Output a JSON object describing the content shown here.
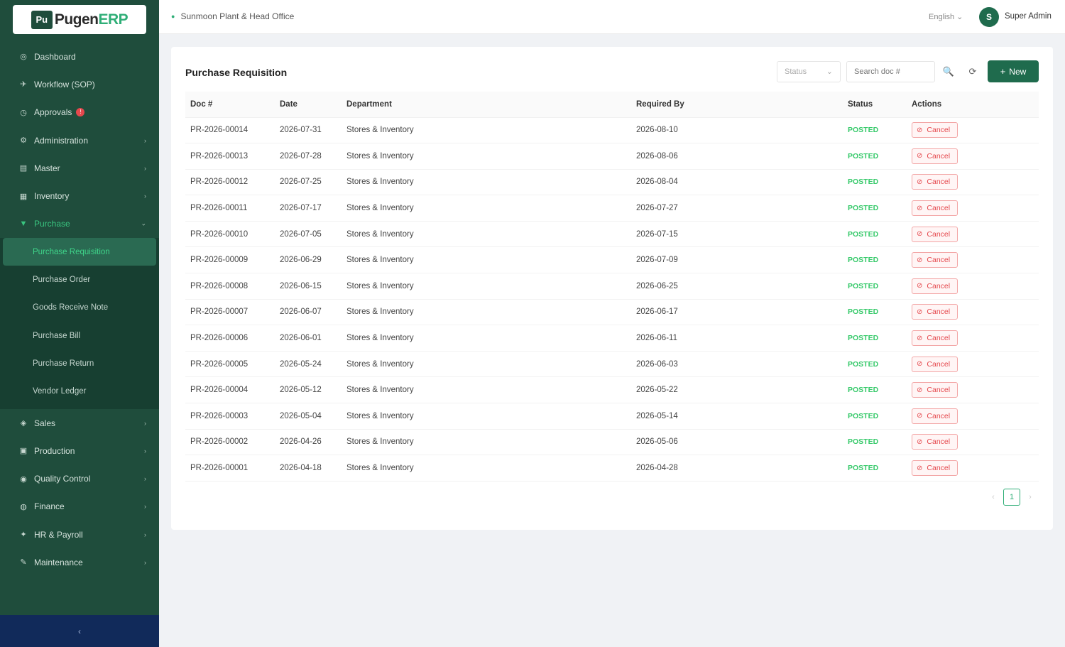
{
  "brand": {
    "logo_mark": "Pu",
    "logo_name": "Pugen",
    "logo_suffix": "ERP"
  },
  "sidebar": {
    "items": [
      {
        "icon": "◎",
        "icon_name": "dashboard-icon",
        "label": "Dashboard",
        "chevron": ""
      },
      {
        "icon": "✈",
        "icon_name": "workflow-icon",
        "label": "Workflow (SOP)",
        "chevron": ""
      },
      {
        "icon": "◷",
        "icon_name": "approvals-icon",
        "label": "Approvals",
        "chevron": "",
        "badge": "!"
      },
      {
        "icon": "⚙",
        "icon_name": "settings-icon",
        "label": "Administration",
        "chevron": "›"
      },
      {
        "icon": "▤",
        "icon_name": "master-icon",
        "label": "Master",
        "chevron": "›"
      },
      {
        "icon": "▦",
        "icon_name": "inventory-icon",
        "label": "Inventory",
        "chevron": "›"
      },
      {
        "icon": "▼",
        "icon_name": "purchase-icon",
        "label": "Purchase",
        "chevron": "⌄"
      }
    ],
    "purchase_sub": [
      {
        "label": "Purchase Requisition"
      },
      {
        "label": "Purchase Order"
      },
      {
        "label": "Goods Receive Note"
      },
      {
        "label": "Purchase Bill"
      },
      {
        "label": "Purchase Return"
      },
      {
        "label": "Vendor Ledger"
      }
    ],
    "items_after": [
      {
        "icon": "◈",
        "icon_name": "sales-icon",
        "label": "Sales",
        "chevron": "›"
      },
      {
        "icon": "▣",
        "icon_name": "production-icon",
        "label": "Production",
        "chevron": "›"
      },
      {
        "icon": "◉",
        "icon_name": "quality-icon",
        "label": "Quality Control",
        "chevron": "›"
      },
      {
        "icon": "◍",
        "icon_name": "finance-icon",
        "label": "Finance",
        "chevron": "›"
      },
      {
        "icon": "✦",
        "icon_name": "hr-icon",
        "label": "HR & Payroll",
        "chevron": "›"
      },
      {
        "icon": "✎",
        "icon_name": "maintenance-icon",
        "label": "Maintenance",
        "chevron": "›"
      }
    ],
    "collapse_label": "‹"
  },
  "header": {
    "breadcrumb_icon": "●",
    "breadcrumb": "Sunmoon Plant & Head Office",
    "language": "English ⌄",
    "avatar_initial": "S",
    "user_name": "Super Admin"
  },
  "card": {
    "title": "Purchase Requisition",
    "status_filter": "Status",
    "status_caret": "⌄",
    "search_placeholder": "Search doc #",
    "search_icon": "🔍",
    "refresh_icon": "⟳",
    "new_label": "New",
    "new_plus": "+"
  },
  "table": {
    "columns": [
      "Doc #",
      "Date",
      "Department",
      "Required By",
      "Status",
      "Actions"
    ],
    "cancel_label": "Cancel",
    "cancel_icon": "⊘",
    "rows": [
      {
        "doc": "PR-2026-00014",
        "date": "2026-07-31",
        "dept": "Stores & Inventory",
        "req": "2026-08-10",
        "status": "POSTED"
      },
      {
        "doc": "PR-2026-00013",
        "date": "2026-07-28",
        "dept": "Stores & Inventory",
        "req": "2026-08-06",
        "status": "POSTED"
      },
      {
        "doc": "PR-2026-00012",
        "date": "2026-07-25",
        "dept": "Stores & Inventory",
        "req": "2026-08-04",
        "status": "POSTED"
      },
      {
        "doc": "PR-2026-00011",
        "date": "2026-07-17",
        "dept": "Stores & Inventory",
        "req": "2026-07-27",
        "status": "POSTED"
      },
      {
        "doc": "PR-2026-00010",
        "date": "2026-07-05",
        "dept": "Stores & Inventory",
        "req": "2026-07-15",
        "status": "POSTED"
      },
      {
        "doc": "PR-2026-00009",
        "date": "2026-06-29",
        "dept": "Stores & Inventory",
        "req": "2026-07-09",
        "status": "POSTED"
      },
      {
        "doc": "PR-2026-00008",
        "date": "2026-06-15",
        "dept": "Stores & Inventory",
        "req": "2026-06-25",
        "status": "POSTED"
      },
      {
        "doc": "PR-2026-00007",
        "date": "2026-06-07",
        "dept": "Stores & Inventory",
        "req": "2026-06-17",
        "status": "POSTED"
      },
      {
        "doc": "PR-2026-00006",
        "date": "2026-06-01",
        "dept": "Stores & Inventory",
        "req": "2026-06-11",
        "status": "POSTED"
      },
      {
        "doc": "PR-2026-00005",
        "date": "2026-05-24",
        "dept": "Stores & Inventory",
        "req": "2026-06-03",
        "status": "POSTED"
      },
      {
        "doc": "PR-2026-00004",
        "date": "2026-05-12",
        "dept": "Stores & Inventory",
        "req": "2026-05-22",
        "status": "POSTED"
      },
      {
        "doc": "PR-2026-00003",
        "date": "2026-05-04",
        "dept": "Stores & Inventory",
        "req": "2026-05-14",
        "status": "POSTED"
      },
      {
        "doc": "PR-2026-00002",
        "date": "2026-04-26",
        "dept": "Stores & Inventory",
        "req": "2026-05-06",
        "status": "POSTED"
      },
      {
        "doc": "PR-2026-00001",
        "date": "2026-04-18",
        "dept": "Stores & Inventory",
        "req": "2026-04-28",
        "status": "POSTED"
      }
    ]
  },
  "pagination": {
    "prev": "‹",
    "page": "1",
    "next": "›"
  }
}
